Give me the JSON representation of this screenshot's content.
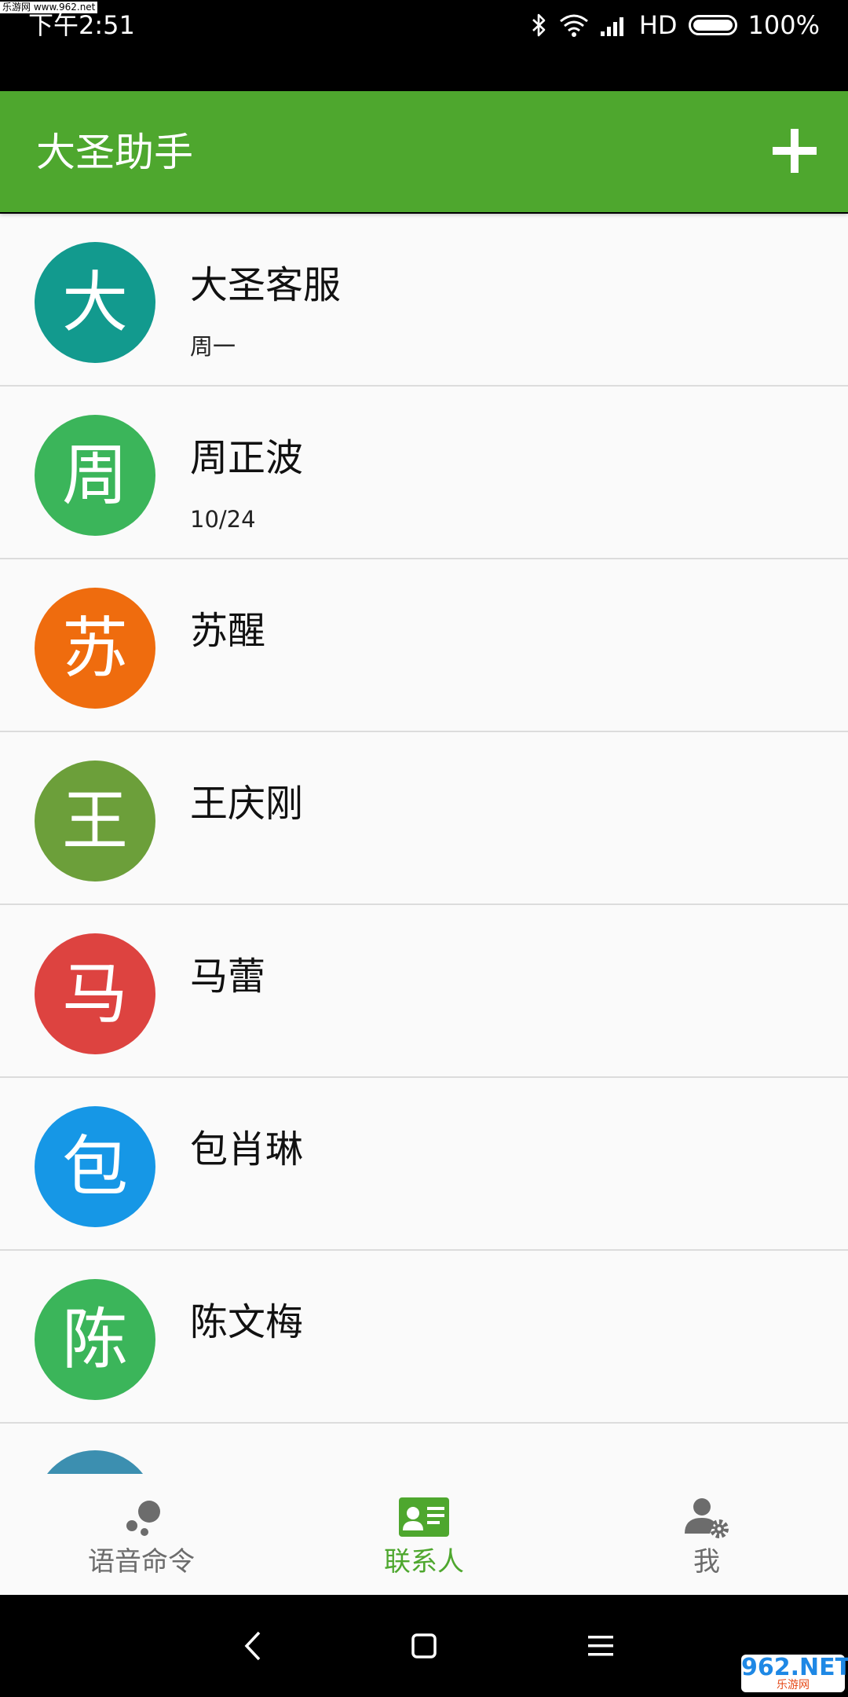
{
  "watermark": {
    "top_text": "乐游网 www.962.net",
    "logo_text": "962.NET",
    "logo_sub": "乐游网"
  },
  "statusbar": {
    "time": "下午2:51",
    "network": "HD",
    "battery": "100%"
  },
  "appbar": {
    "title": "大圣助手",
    "add_icon": "plus-icon"
  },
  "contacts": [
    {
      "initial": "大",
      "name": "大圣客服",
      "subtitle": "周一",
      "color": "#129a8e"
    },
    {
      "initial": "周",
      "name": "周正波",
      "subtitle": "10/24",
      "color": "#3bb55a"
    },
    {
      "initial": "苏",
      "name": "苏醒",
      "subtitle": "",
      "color": "#ef6c0e"
    },
    {
      "initial": "王",
      "name": "王庆刚",
      "subtitle": "",
      "color": "#6c9f3a"
    },
    {
      "initial": "马",
      "name": "马蕾",
      "subtitle": "",
      "color": "#dd4340"
    },
    {
      "initial": "包",
      "name": "包肖琳",
      "subtitle": "",
      "color": "#1697e6"
    },
    {
      "initial": "陈",
      "name": "陈文梅",
      "subtitle": "",
      "color": "#3bb55a"
    },
    {
      "initial": "",
      "name": "",
      "subtitle": "",
      "color": "#3c8fb0"
    }
  ],
  "bottomnav": {
    "tabs": [
      {
        "label": "语音命令",
        "icon": "voice-command-icon",
        "active": false
      },
      {
        "label": "联系人",
        "icon": "contact-card-icon",
        "active": true
      },
      {
        "label": "我",
        "icon": "user-settings-icon",
        "active": false
      }
    ]
  },
  "colors": {
    "primary": "#4ea72e",
    "inactive": "#6c6c6c"
  }
}
